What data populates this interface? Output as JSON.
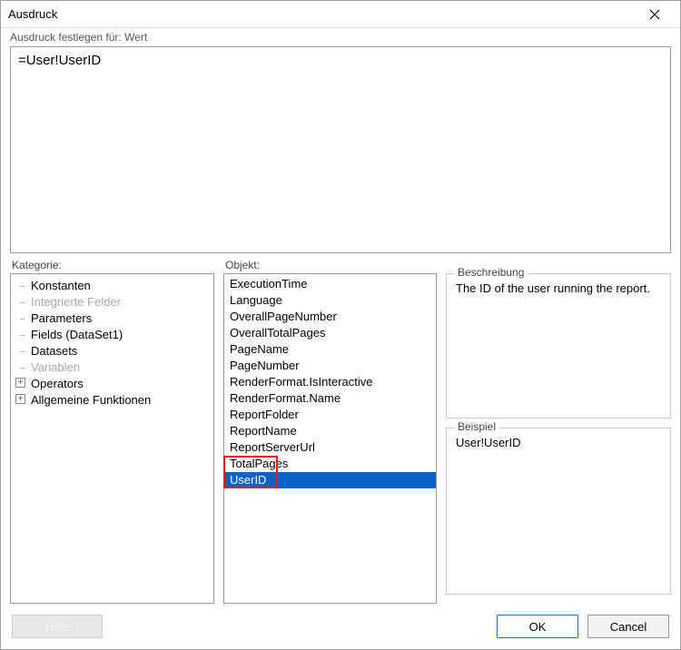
{
  "title": "Ausdruck",
  "subtitle": "Ausdruck festlegen für: Wert",
  "expression": "=User!UserID",
  "labels": {
    "category": "Kategorie:",
    "object": "Objekt:",
    "description": "Beschreibung",
    "example": "Beispiel"
  },
  "category": {
    "items": [
      {
        "label": "Konstanten",
        "expandable": false,
        "disabled": false
      },
      {
        "label": "Integrierte Felder",
        "expandable": false,
        "disabled": true
      },
      {
        "label": "Parameters",
        "expandable": false,
        "disabled": false
      },
      {
        "label": "Fields (DataSet1)",
        "expandable": false,
        "disabled": false
      },
      {
        "label": "Datasets",
        "expandable": false,
        "disabled": false
      },
      {
        "label": "Variablen",
        "expandable": false,
        "disabled": true
      },
      {
        "label": "Operators",
        "expandable": true,
        "disabled": false
      },
      {
        "label": "Allgemeine Funktionen",
        "expandable": true,
        "disabled": false
      }
    ]
  },
  "object": {
    "items": [
      "ExecutionTime",
      "Language",
      "OverallPageNumber",
      "OverallTotalPages",
      "PageName",
      "PageNumber",
      "RenderFormat.IsInteractive",
      "RenderFormat.Name",
      "ReportFolder",
      "ReportName",
      "ReportServerUrl",
      "TotalPages",
      "UserID"
    ],
    "selected_index": 12
  },
  "description": "The ID of the user running the report.",
  "example": "User!UserID",
  "buttons": {
    "help": "Hilfe",
    "ok": "OK",
    "cancel": "Cancel"
  }
}
